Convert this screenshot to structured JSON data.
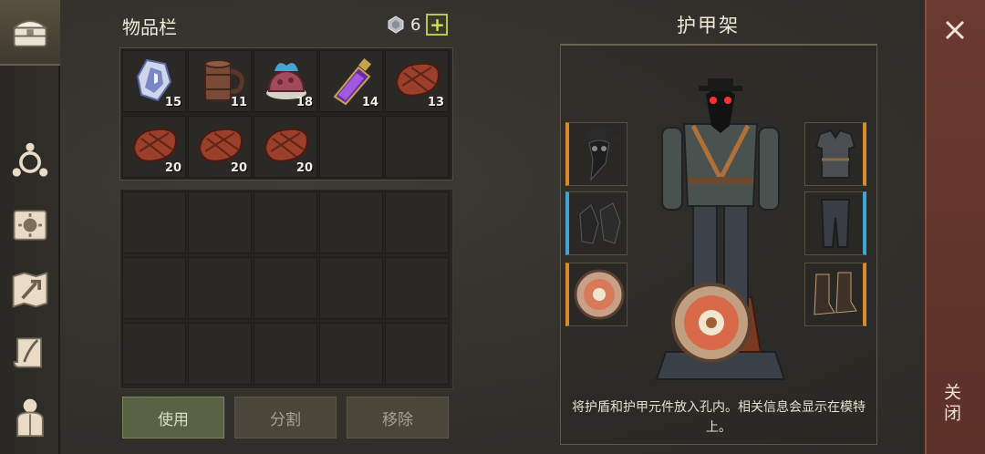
{
  "inventory": {
    "title": "物品栏",
    "currency_icon": "gem-icon",
    "currency_count": "6",
    "add_label": "+",
    "items": [
      {
        "name": "crystal-shard",
        "count": "15"
      },
      {
        "name": "wooden-mug",
        "count": "11"
      },
      {
        "name": "blue-flame-pie",
        "count": "18"
      },
      {
        "name": "purple-potion",
        "count": "14"
      },
      {
        "name": "cooked-meat",
        "count": "13"
      },
      {
        "name": "cooked-meat",
        "count": "20"
      },
      {
        "name": "cooked-meat",
        "count": "20"
      },
      {
        "name": "cooked-meat",
        "count": "20"
      }
    ],
    "buttons": {
      "use": "使用",
      "split": "分割",
      "remove": "移除"
    }
  },
  "armor_stand": {
    "title": "护甲架",
    "slots_left": [
      "plague-doctor-mask",
      "leather-gloves",
      "round-shield"
    ],
    "slots_right": [
      "chest-armor",
      "leg-armor",
      "boots"
    ],
    "description": "将护盾和护甲元件放入孔内。相关信息会显示在模特上。"
  },
  "close": {
    "label": "关闭"
  },
  "colors": {
    "accent_orange": "#d98a2a",
    "accent_blue": "#3fa6d4",
    "close_bg": "#6a3a30",
    "use_button": "#5a6244"
  },
  "sidebar": {
    "items": [
      "chest-icon",
      "skills-icon",
      "recipes-icon",
      "map-icon",
      "quest-scroll-icon",
      "character-icon"
    ]
  }
}
